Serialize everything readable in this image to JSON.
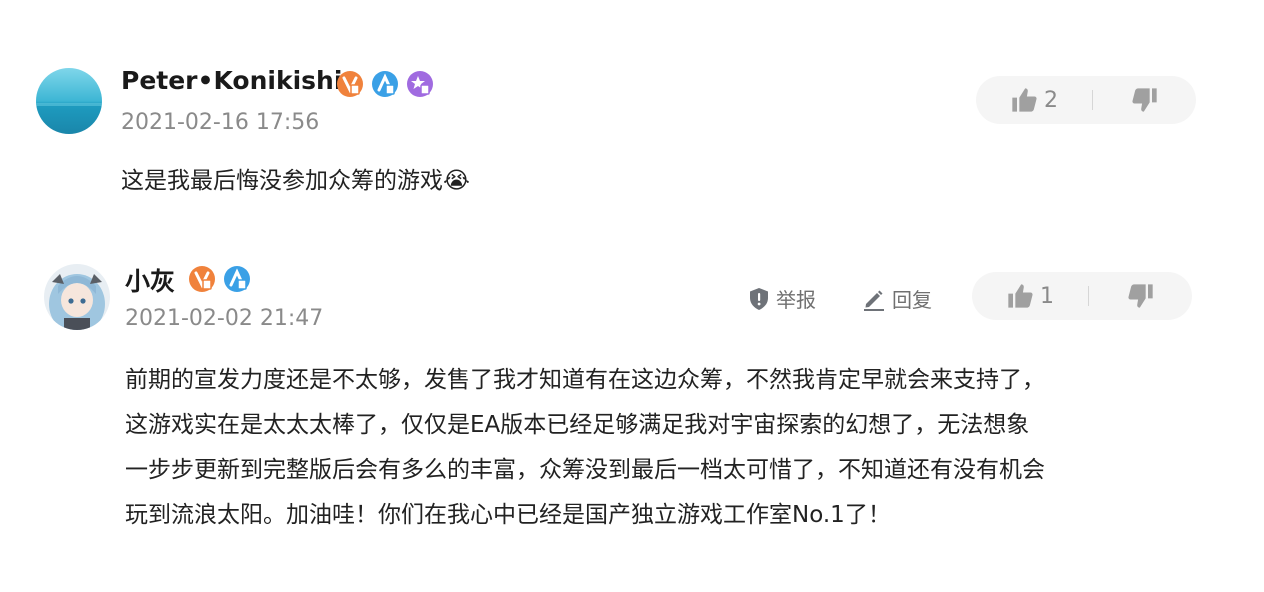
{
  "comments": [
    {
      "username": "Peter•Konikishi",
      "timestamp": "2021-02-16 17:56",
      "content_lines": [
        "这是我最后悔没参加众筹的游戏😭"
      ],
      "likes": "2",
      "badges": [
        "orange-badge-icon",
        "blue-badge-icon",
        "purple-star-badge-icon"
      ]
    },
    {
      "username": "小灰",
      "timestamp": "2021-02-02 21:47",
      "report_label": "举报",
      "reply_label": "回复",
      "content_lines": [
        "前期的宣发力度还是不太够，发售了我才知道有在这边众筹，不然我肯定早就会来支持了，",
        "这游戏实在是太太太棒了，仅仅是EA版本已经足够满足我对宇宙探索的幻想了，无法想象",
        "一步步更新到完整版后会有多么的丰富，众筹没到最后一档太可惜了，不知道还有没有机会",
        "玩到流浪太阳。加油哇！你们在我心中已经是国产独立游戏工作室No.1了！"
      ],
      "likes": "1",
      "badges": [
        "orange-badge-icon",
        "blue-badge-icon"
      ]
    }
  ],
  "colors": {
    "orange": "#f0823c",
    "blue": "#3aa0e6",
    "purple": "#a06be0",
    "gray_text": "#8a8a8a",
    "pill_bg": "#f5f5f5"
  }
}
